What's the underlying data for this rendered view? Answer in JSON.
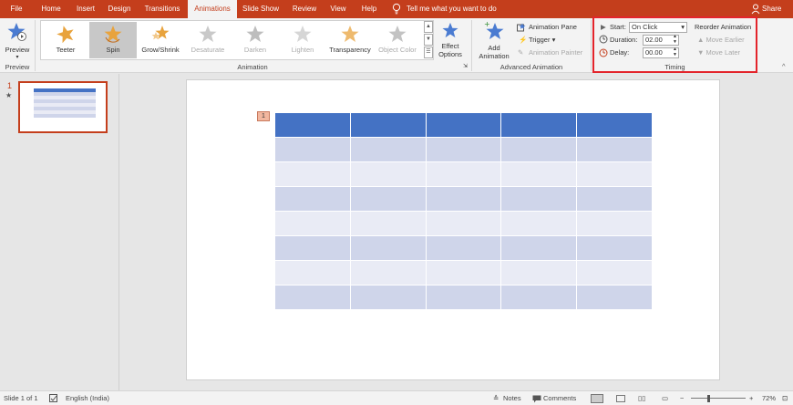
{
  "tabs": [
    {
      "label": "File",
      "active": false
    },
    {
      "label": "Home",
      "active": false
    },
    {
      "label": "Insert",
      "active": false
    },
    {
      "label": "Design",
      "active": false
    },
    {
      "label": "Transitions",
      "active": false
    },
    {
      "label": "Animations",
      "active": true
    },
    {
      "label": "Slide Show",
      "active": false
    },
    {
      "label": "Review",
      "active": false
    },
    {
      "label": "View",
      "active": false
    },
    {
      "label": "Help",
      "active": false
    }
  ],
  "tell_me": "Tell me what you want to do",
  "share": "Share",
  "preview_group": {
    "button": "Preview",
    "label": "Preview"
  },
  "animation_group": {
    "label": "Animation",
    "items": [
      {
        "label": "Teeter",
        "icon": "teeter-star-icon",
        "selected": false,
        "disabled": false
      },
      {
        "label": "Spin",
        "icon": "spin-star-icon",
        "selected": true,
        "disabled": false
      },
      {
        "label": "Grow/Shrink",
        "icon": "grow-shrink-star-icon",
        "selected": false,
        "disabled": false
      },
      {
        "label": "Desaturate",
        "icon": "desaturate-star-icon",
        "selected": false,
        "disabled": true
      },
      {
        "label": "Darken",
        "icon": "darken-star-icon",
        "selected": false,
        "disabled": true
      },
      {
        "label": "Lighten",
        "icon": "lighten-star-icon",
        "selected": false,
        "disabled": true
      },
      {
        "label": "Transparency",
        "icon": "transparency-star-icon",
        "selected": false,
        "disabled": false
      },
      {
        "label": "Object Color",
        "icon": "object-color-star-icon",
        "selected": false,
        "disabled": true
      }
    ],
    "effect_options": {
      "line1": "Effect",
      "line2": "Options"
    }
  },
  "advanced_group": {
    "label": "Advanced Animation",
    "add_animation": {
      "line1": "Add",
      "line2": "Animation"
    },
    "animation_pane": "Animation Pane",
    "trigger": "Trigger",
    "animation_painter": "Animation Painter"
  },
  "timing_group": {
    "label": "Timing",
    "start_label": "Start:",
    "start_value": "On Click",
    "duration_label": "Duration:",
    "duration_value": "02.00",
    "delay_label": "Delay:",
    "delay_value": "00.00",
    "reorder_title": "Reorder Animation",
    "move_earlier": "Move Earlier",
    "move_later": "Move Later"
  },
  "slide_panel": {
    "number": "1",
    "star": "★"
  },
  "slide": {
    "anim_tag": "1",
    "table": {
      "rows": 8,
      "cols": 5
    }
  },
  "status_bar": {
    "slide_info": "Slide 1 of 1",
    "language": "English (India)",
    "notes": "Notes",
    "comments": "Comments",
    "zoom": "72%"
  },
  "colors": {
    "accent": "#c43e1c",
    "table_header": "#4472c4",
    "table_band_dark": "#cfd5ea",
    "table_band_light": "#e9ebf5",
    "highlight": "#e3242b"
  }
}
